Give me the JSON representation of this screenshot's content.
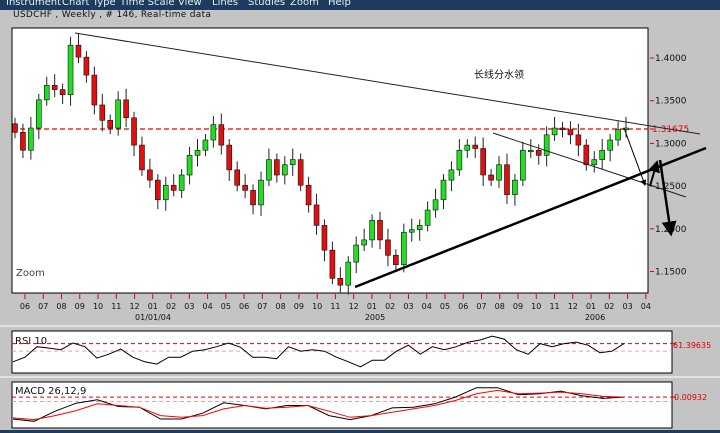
{
  "menu": [
    "Instrument",
    "Chart Type",
    "Time Scale",
    "View",
    "Lines",
    "Studies",
    "Zoom",
    "Help"
  ],
  "title": "USDCHF , Weekly , # 146, Real-time data",
  "main_chart": {
    "zoom_label": "Zoom",
    "annotation": "长线分水领",
    "current_price_label": "1.31675",
    "colors": {
      "up": "#22dd22",
      "down": "#e01010",
      "reference_line": "#e00000"
    }
  },
  "chart_data": [
    {
      "type": "candlestick",
      "instrument": "USDCHF",
      "interval": "Weekly",
      "y_ticks": [
        "1.4000",
        "1.3500",
        "1.3000",
        "1.2500",
        "1.2000",
        "1.1500"
      ],
      "ylim": [
        1.124,
        1.435
      ],
      "reference_line": 1.31675,
      "x_tick_labels": [
        "06",
        "07",
        "08",
        "09",
        "10",
        "11",
        "12",
        "01",
        "02",
        "03",
        "04",
        "05",
        "06",
        "07",
        "08",
        "09",
        "10",
        "11",
        "12",
        "01",
        "02",
        "03",
        "04",
        "05",
        "06",
        "07",
        "08",
        "09",
        "10",
        "11",
        "12",
        "01",
        "02",
        "03",
        "04"
      ],
      "x_year_labels": [
        "01/01/04",
        "2005",
        "2006"
      ],
      "close": [
        1.313,
        1.292,
        1.318,
        1.351,
        1.368,
        1.363,
        1.357,
        1.415,
        1.401,
        1.38,
        1.345,
        1.327,
        1.318,
        1.351,
        1.33,
        1.298,
        1.269,
        1.257,
        1.234,
        1.251,
        1.245,
        1.263,
        1.286,
        1.292,
        1.304,
        1.322,
        1.298,
        1.269,
        1.251,
        1.245,
        1.228,
        1.257,
        1.281,
        1.263,
        1.275,
        1.281,
        1.251,
        1.228,
        1.204,
        1.175,
        1.142,
        1.134,
        1.161,
        1.181,
        1.187,
        1.21,
        1.187,
        1.169,
        1.158,
        1.196,
        1.199,
        1.204,
        1.222,
        1.234,
        1.257,
        1.269,
        1.292,
        1.298,
        1.294,
        1.263,
        1.257,
        1.275,
        1.24,
        1.257,
        1.292,
        1.292,
        1.286,
        1.31,
        1.318,
        1.316,
        1.31,
        1.298,
        1.275,
        1.281,
        1.292,
        1.304,
        1.316,
        1.318
      ]
    },
    {
      "type": "line",
      "title": "RSI 10",
      "current_value_label": "61.39635",
      "ylim": [
        17,
        80.5
      ],
      "reference_levels": [
        61.4,
        50
      ],
      "series": [
        {
          "values": [
            34.0,
            40.9,
            56.8,
            54.6,
            52.3,
            62.3,
            56.8,
            39.5,
            45.4,
            53.2,
            40.9,
            34.0,
            30.4,
            40.9,
            40.9,
            50.0,
            52.3,
            56.8,
            62.3,
            55.9,
            40.9,
            40.9,
            38.6,
            56.8,
            50.0,
            52.3,
            50.0,
            40.9,
            34.0,
            26.3,
            36.3,
            36.3,
            50.0,
            59.1,
            45.4,
            56.8,
            52.3,
            56.8,
            63.7,
            66.9,
            72.8,
            68.2,
            52.3,
            45.4,
            61.4,
            56.8,
            61.4,
            63.7,
            59.1,
            47.7,
            50.0,
            61.4
          ]
        }
      ]
    },
    {
      "type": "line",
      "title": "MACD 26,12,9",
      "current_value_label": "0.00932",
      "ylim": [
        -0.0566,
        0.0416
      ],
      "reference_levels": [
        0.00932,
        0
      ],
      "series": [
        {
          "color": "#000000",
          "values": [
            -0.0373,
            -0.0423,
            -0.0208,
            -0.0036,
            0.0036,
            -0.0108,
            -0.0122,
            -0.0373,
            -0.0373,
            -0.0251,
            -0.0029,
            -0.0086,
            -0.0158,
            -0.0086,
            -0.0086,
            -0.0301,
            -0.0387,
            -0.0301,
            -0.0136,
            -0.0122,
            -0.005,
            0.0093,
            0.0294,
            0.0294,
            0.0143,
            0.0165,
            0.0222,
            0.0122,
            0.0065,
            0.0093
          ]
        },
        {
          "color": "#ff0000",
          "values": [
            -0.0351,
            -0.0387,
            -0.0301,
            -0.0194,
            -0.005,
            -0.0086,
            -0.0122,
            -0.0301,
            -0.0337,
            -0.0301,
            -0.0158,
            -0.0086,
            -0.0143,
            -0.0122,
            -0.0086,
            -0.0208,
            -0.0337,
            -0.0301,
            -0.0229,
            -0.0158,
            -0.0086,
            0.0022,
            0.0165,
            0.0237,
            0.0165,
            0.0179,
            0.0201,
            0.0165,
            0.0108,
            0.0093
          ]
        }
      ]
    }
  ]
}
